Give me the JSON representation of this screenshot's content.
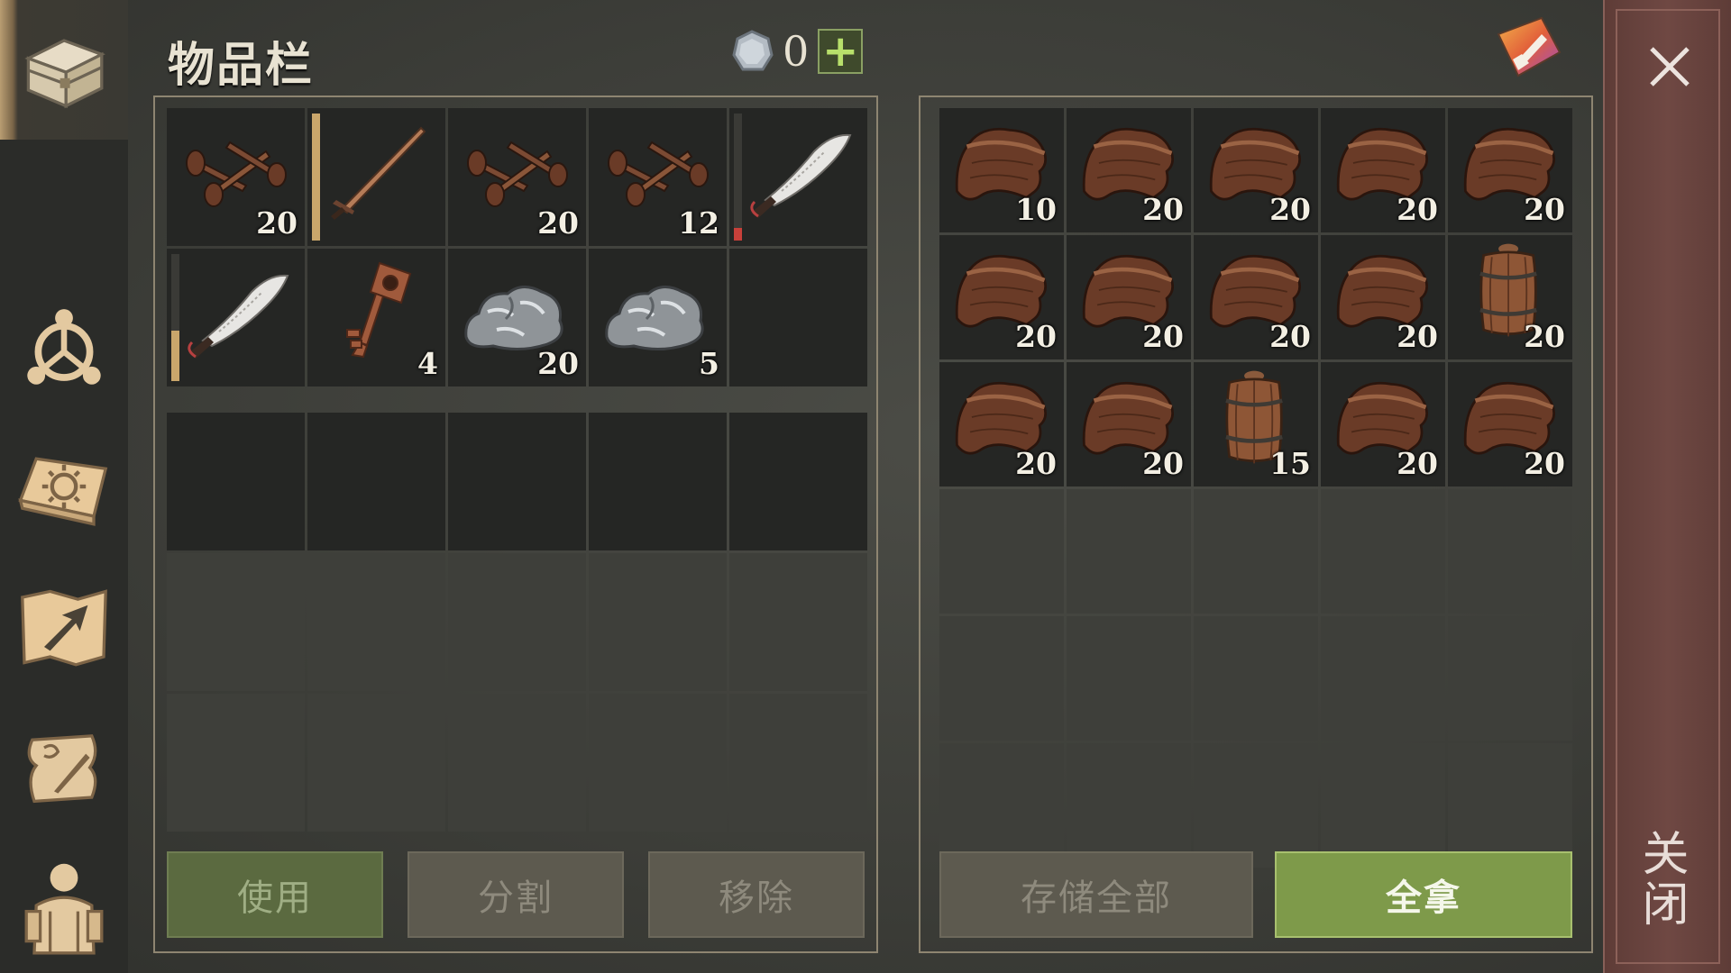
{
  "title": "物品栏",
  "currency": {
    "icon": "silver-coin-icon",
    "value": "0",
    "add_label": "+"
  },
  "sidebar": {
    "items": [
      {
        "name": "inventory",
        "icon": "chest-icon",
        "active": true
      },
      {
        "name": "skills",
        "icon": "skill-tree-icon",
        "active": false
      },
      {
        "name": "recipes",
        "icon": "sun-book-icon",
        "active": false
      },
      {
        "name": "map",
        "icon": "map-arrow-icon",
        "active": false
      },
      {
        "name": "quests",
        "icon": "scroll-quill-icon",
        "active": false
      },
      {
        "name": "character",
        "icon": "character-icon",
        "active": false
      }
    ]
  },
  "inventory": {
    "slots": [
      {
        "item": "nails",
        "qty": "20"
      },
      {
        "item": "sword",
        "qty": "",
        "durability": 1.0,
        "dur_color": "#c9a66b"
      },
      {
        "item": "nails",
        "qty": "20"
      },
      {
        "item": "nails",
        "qty": "12"
      },
      {
        "item": "machete",
        "qty": "",
        "durability": 0.1,
        "dur_color": "#c8403a"
      },
      {
        "item": "machete",
        "qty": "",
        "durability": 0.4,
        "dur_color": "#c9a66b"
      },
      {
        "item": "key",
        "qty": "4"
      },
      {
        "item": "stone",
        "qty": "20"
      },
      {
        "item": "stone",
        "qty": "5"
      },
      {
        "item": "",
        "qty": ""
      }
    ]
  },
  "container": {
    "slots": [
      {
        "item": "leather",
        "qty": "10"
      },
      {
        "item": "leather",
        "qty": "20"
      },
      {
        "item": "leather",
        "qty": "20"
      },
      {
        "item": "leather",
        "qty": "20"
      },
      {
        "item": "leather",
        "qty": "20"
      },
      {
        "item": "leather",
        "qty": "20"
      },
      {
        "item": "leather",
        "qty": "20"
      },
      {
        "item": "leather",
        "qty": "20"
      },
      {
        "item": "leather",
        "qty": "20"
      },
      {
        "item": "barrel",
        "qty": "20"
      },
      {
        "item": "leather",
        "qty": "20"
      },
      {
        "item": "leather",
        "qty": "20"
      },
      {
        "item": "barrel",
        "qty": "15"
      },
      {
        "item": "leather",
        "qty": "20"
      },
      {
        "item": "leather",
        "qty": "20"
      }
    ]
  },
  "buttons": {
    "use": "使用",
    "split": "分割",
    "remove": "移除",
    "store_all": "存储全部",
    "take_all": "全拿"
  },
  "close": {
    "label": "关闭",
    "icon": "close-icon"
  },
  "colors": {
    "accent_green": "#7e9a4a",
    "panel_border": "#8e8571",
    "close_bar": "#6f4843"
  }
}
